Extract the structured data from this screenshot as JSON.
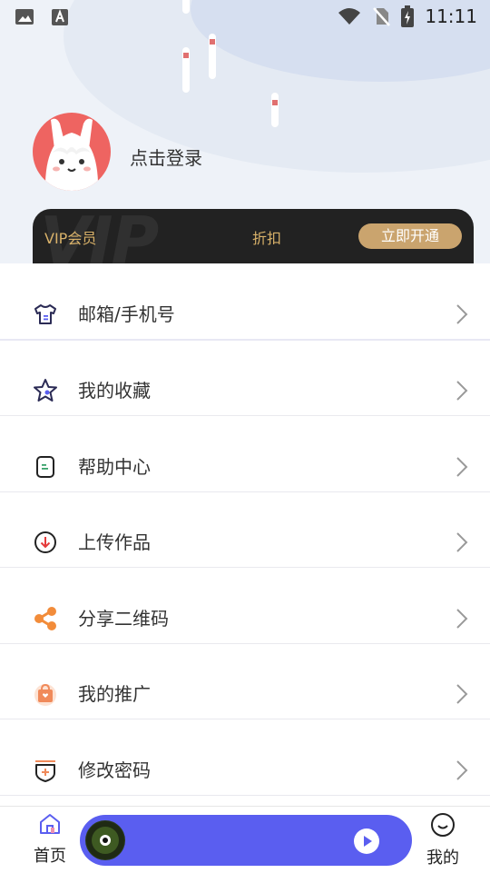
{
  "status_bar": {
    "time": "11:11"
  },
  "profile": {
    "login_prompt": "点击登录"
  },
  "vip": {
    "label": "VIP会员",
    "discount": "折扣",
    "button": "立即开通",
    "watermark": "VIP"
  },
  "menu": {
    "items": [
      {
        "label": "邮箱/手机号",
        "icon": "shirt-icon"
      },
      {
        "label": "我的收藏",
        "icon": "star-icon"
      },
      {
        "label": "帮助中心",
        "icon": "note-icon"
      },
      {
        "label": "上传作品",
        "icon": "download-circle-icon"
      },
      {
        "label": "分享二维码",
        "icon": "share-icon"
      },
      {
        "label": "我的推广",
        "icon": "shop-bag-icon"
      },
      {
        "label": "修改密码",
        "icon": "shield-plus-icon"
      }
    ]
  },
  "bottom_nav": {
    "home_label": "首页",
    "mine_label": "我的"
  },
  "colors": {
    "accent": "#5a5ef0",
    "vip_gold": "#caa46e",
    "avatar_bg": "#ee6461"
  }
}
